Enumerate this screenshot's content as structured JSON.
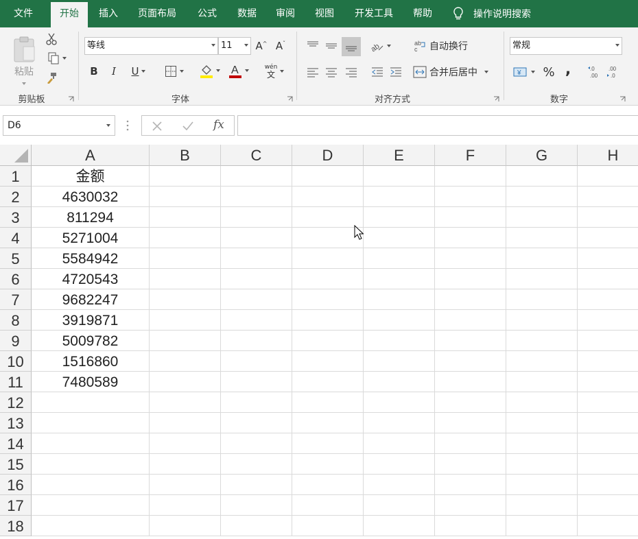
{
  "tabs": [
    {
      "label": "文件",
      "active": false
    },
    {
      "label": "开始",
      "active": true
    },
    {
      "label": "插入",
      "active": false
    },
    {
      "label": "页面布局",
      "active": false
    },
    {
      "label": "公式",
      "active": false
    },
    {
      "label": "数据",
      "active": false
    },
    {
      "label": "审阅",
      "active": false
    },
    {
      "label": "视图",
      "active": false
    },
    {
      "label": "开发工具",
      "active": false
    },
    {
      "label": "帮助",
      "active": false
    }
  ],
  "tell_me": "操作说明搜索",
  "ribbon": {
    "clipboard": {
      "label": "剪贴板",
      "paste": "粘贴"
    },
    "font": {
      "label": "字体",
      "font_name": "等线",
      "font_size": "11",
      "bold": "B",
      "italic": "I",
      "underline": "U",
      "phonetic_top": "wén",
      "phonetic_bottom": "文"
    },
    "alignment": {
      "label": "对齐方式",
      "wrap_text": "自动换行",
      "merge_center": "合并后居中"
    },
    "number": {
      "label": "数字",
      "format": "常规",
      "percent": "%",
      "comma": ","
    }
  },
  "formula_bar": {
    "name_box": "D6",
    "fx": "fx",
    "formula": ""
  },
  "accent": "#217346",
  "columns": [
    "A",
    "B",
    "C",
    "D",
    "E",
    "F",
    "G",
    "H"
  ],
  "rows": [
    "1",
    "2",
    "3",
    "4",
    "5",
    "6",
    "7",
    "8",
    "9",
    "10",
    "11",
    "12",
    "13",
    "14",
    "15",
    "16",
    "17",
    "18"
  ],
  "column_a": [
    "金额",
    "4630032",
    "811294",
    "5271004",
    "5584942",
    "4720543",
    "9682247",
    "3919871",
    "5009782",
    "1516860",
    "7480589",
    "",
    "",
    "",
    "",
    "",
    "",
    ""
  ]
}
